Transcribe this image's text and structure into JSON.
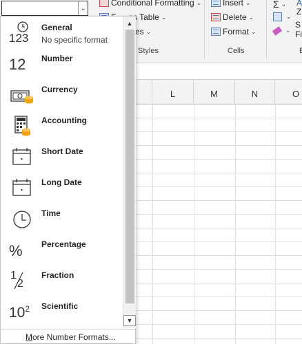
{
  "ribbon": {
    "styles": {
      "conditional_formatting": "Conditional Formatting",
      "format_as_table": "as Table",
      "format_as_table_prefix": "F",
      "cell_styles": "es",
      "group_label": "Styles"
    },
    "cells": {
      "insert": "Insert",
      "delete": "Delete",
      "format": "Format",
      "group_label": "Cells"
    },
    "editing": {
      "autosum_icon": "Σ",
      "sort_char": "Z",
      "sort_char2": "A",
      "sort_trunc": "S",
      "find_trunc": "Fi",
      "group_label_trunc": "E"
    }
  },
  "columns": [
    "L",
    "M",
    "N",
    "O"
  ],
  "number_format": {
    "combo_value": "",
    "items": [
      {
        "name": "General",
        "desc": "No specific format",
        "icon": "clock-123-icon"
      },
      {
        "name": "Number",
        "desc": "",
        "icon": "number-12-icon",
        "glyph": "12"
      },
      {
        "name": "Currency",
        "desc": "",
        "icon": "currency-icon"
      },
      {
        "name": "Accounting",
        "desc": "",
        "icon": "calculator-icon"
      },
      {
        "name": "Short Date",
        "desc": "",
        "icon": "calendar-icon"
      },
      {
        "name": "Long Date",
        "desc": "",
        "icon": "calendar-icon"
      },
      {
        "name": "Time",
        "desc": "",
        "icon": "clock-icon"
      },
      {
        "name": "Percentage",
        "desc": "",
        "icon": "percent-icon",
        "glyph": "%"
      },
      {
        "name": "Fraction",
        "desc": "",
        "icon": "fraction-icon"
      },
      {
        "name": "Scientific",
        "desc": "",
        "icon": "scientific-icon"
      }
    ],
    "glyphs": {
      "general": "123",
      "fraction_num": "1",
      "fraction_den": "2",
      "sci_base": "10",
      "sci_exp": "2"
    },
    "more_label_first": "M",
    "more_label_rest": "ore Number Formats..."
  },
  "colors": {
    "accent": "#217346",
    "icon_orange": "#f0a30a",
    "icon_blue": "#2b579a"
  }
}
